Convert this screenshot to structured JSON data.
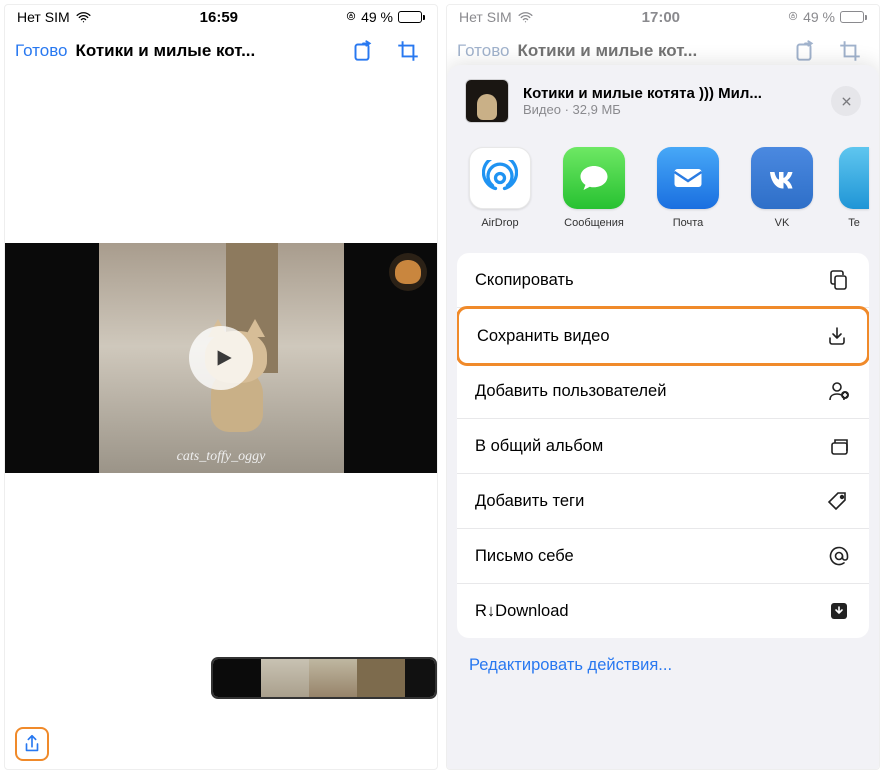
{
  "phone1": {
    "status": {
      "carrier": "Нет SIM",
      "time": "16:59",
      "battery_pct": "49 %"
    },
    "nav": {
      "done": "Готово",
      "title": "Котики и  милые кот..."
    },
    "caption": "cats_toffy_oggy"
  },
  "phone2": {
    "status": {
      "carrier": "Нет SIM",
      "time": "17:00",
      "battery_pct": "49 %"
    },
    "nav": {
      "done": "Готово",
      "title": "Котики и  милые кот..."
    },
    "sheet_header": {
      "title": "Котики и  милые котята ))) Мил...",
      "subtitle": "Видео · 32,9 МБ"
    },
    "apps": [
      {
        "label": "AirDrop"
      },
      {
        "label": "Сообщения"
      },
      {
        "label": "Почта"
      },
      {
        "label": "VK"
      },
      {
        "label": "Te"
      }
    ],
    "actions": [
      {
        "label": "Скопировать",
        "icon": "copy"
      },
      {
        "label": "Сохранить видео",
        "icon": "download",
        "highlight": true
      },
      {
        "label": "Добавить пользователей",
        "icon": "add-user"
      },
      {
        "label": "В общий альбом",
        "icon": "album"
      },
      {
        "label": "Добавить теги",
        "icon": "tag"
      },
      {
        "label": "Письмо себе",
        "icon": "at"
      },
      {
        "label": "R↓Download",
        "icon": "save"
      }
    ],
    "edit_link": "Редактировать действия..."
  }
}
